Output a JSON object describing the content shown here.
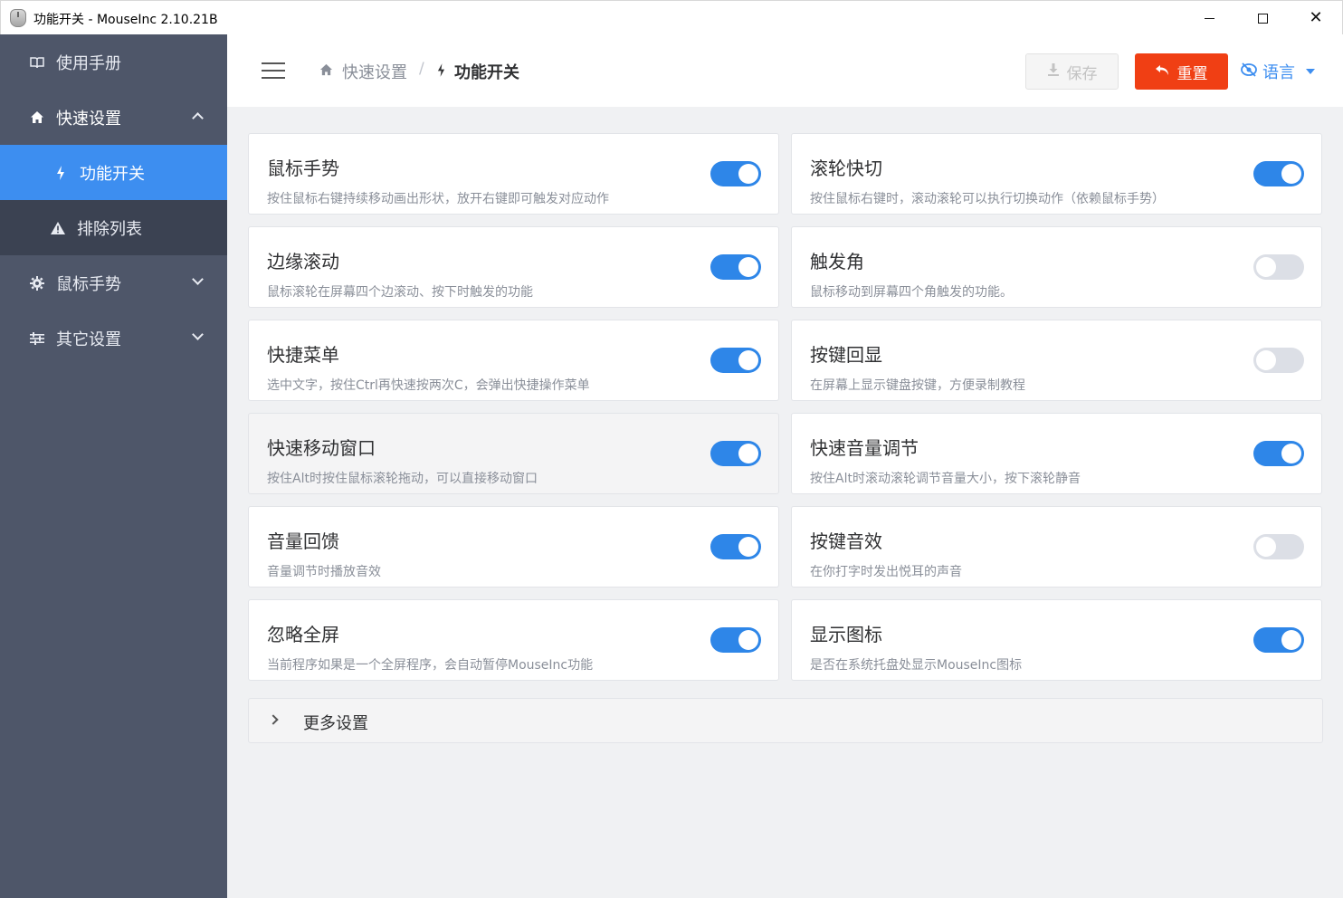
{
  "window": {
    "title": "功能开关 - MouseInc 2.10.21B",
    "minimize_glyph": "",
    "close_glyph": "✕"
  },
  "sidebar": {
    "items": [
      {
        "label": "使用手册",
        "icon": "book-icon"
      },
      {
        "label": "快速设置",
        "icon": "home-icon",
        "expanded": true
      },
      {
        "label": "功能开关",
        "icon": "bolt-icon",
        "active": true
      },
      {
        "label": "排除列表",
        "icon": "warning-icon"
      },
      {
        "label": "鼠标手势",
        "icon": "gear-icon",
        "expanded": false
      },
      {
        "label": "其它设置",
        "icon": "sliders-icon",
        "expanded": false
      }
    ]
  },
  "header": {
    "breadcrumb": [
      {
        "label": "快速设置",
        "icon": "home-icon"
      },
      {
        "label": "功能开关",
        "icon": "bolt-icon"
      }
    ],
    "separator": "/",
    "save_label": "保存",
    "reset_label": "重置",
    "language_label": "语言"
  },
  "features": [
    {
      "title": "鼠标手势",
      "desc": "按住鼠标右键持续移动画出形状，放开右键即可触发对应动作",
      "enabled": true
    },
    {
      "title": "滚轮快切",
      "desc": "按住鼠标右键时，滚动滚轮可以执行切换动作（依赖鼠标手势）",
      "enabled": true
    },
    {
      "title": "边缘滚动",
      "desc": "鼠标滚轮在屏幕四个边滚动、按下时触发的功能",
      "enabled": true
    },
    {
      "title": "触发角",
      "desc": "鼠标移动到屏幕四个角触发的功能。",
      "enabled": false
    },
    {
      "title": "快捷菜单",
      "desc": "选中文字，按住Ctrl再快速按两次C，会弹出快捷操作菜单",
      "enabled": true
    },
    {
      "title": "按键回显",
      "desc": "在屏幕上显示键盘按键，方便录制教程",
      "enabled": false
    },
    {
      "title": "快速移动窗口",
      "desc": "按住Alt时按住鼠标滚轮拖动，可以直接移动窗口",
      "enabled": true
    },
    {
      "title": "快速音量调节",
      "desc": "按住Alt时滚动滚轮调节音量大小，按下滚轮静音",
      "enabled": true
    },
    {
      "title": "音量回馈",
      "desc": "音量调节时播放音效",
      "enabled": true
    },
    {
      "title": "按键音效",
      "desc": "在你打字时发出悦耳的声音",
      "enabled": false
    },
    {
      "title": "忽略全屏",
      "desc": "当前程序如果是一个全屏程序，会自动暂停MouseInc功能",
      "enabled": true
    },
    {
      "title": "显示图标",
      "desc": "是否在系统托盘处显示MouseInc图标",
      "enabled": true
    }
  ],
  "more_settings": {
    "label": "更多设置",
    "expanded": false
  },
  "colors": {
    "sidebar_bg": "#4e5669",
    "sidebar_active": "#3d8ef0",
    "toggle_on": "#2e86e8",
    "toggle_off": "#dcdfe6",
    "reset_button": "#f03f14",
    "accent": "#3d8ef0"
  }
}
